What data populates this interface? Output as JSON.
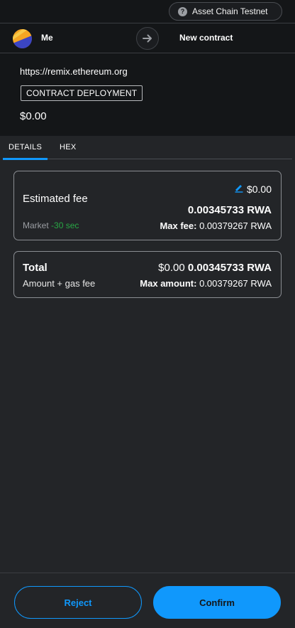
{
  "header": {
    "network_label": "Asset Chain Testnet",
    "network_icon": "help-icon"
  },
  "accounts": {
    "from_label": "Me",
    "to_label": "New contract",
    "arrow_icon": "arrow-right-icon"
  },
  "origin": {
    "url": "https://remix.ethereum.org",
    "transaction_type": "CONTRACT DEPLOYMENT",
    "amount": "$0.00"
  },
  "tabs": [
    {
      "label": "DETAILS",
      "active": true
    },
    {
      "label": "HEX",
      "active": false
    }
  ],
  "fee": {
    "title": "Estimated fee",
    "fiat": "$0.00",
    "crypto": "0.00345733 RWA",
    "market_label": "Market",
    "market_time": "-30 sec",
    "max_fee_label": "Max fee:",
    "max_fee_value": "0.00379267 RWA"
  },
  "total": {
    "label": "Total",
    "sublabel": "Amount + gas fee",
    "fiat": "$0.00",
    "crypto": "0.00345733 RWA",
    "max_amount_label": "Max amount:",
    "max_amount_value": "0.00379267 RWA"
  },
  "actions": {
    "reject_label": "Reject",
    "confirm_label": "Confirm"
  },
  "colors": {
    "accent": "#1098fc",
    "success": "#28a745",
    "background": "#232528",
    "header_background": "#141618"
  }
}
